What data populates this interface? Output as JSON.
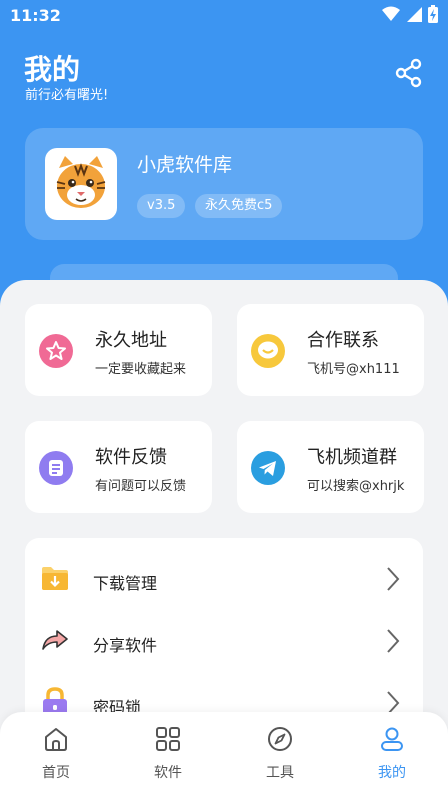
{
  "status_bar": {
    "time": "11:32"
  },
  "header": {
    "title": "我的",
    "subtitle": "前行必有曙光!"
  },
  "profile": {
    "name": "小虎软件库",
    "version": "v3.5",
    "badge": "永久免费c5"
  },
  "grid": [
    {
      "title": "永久地址",
      "sub": "一定要收藏起来",
      "icon": "star-icon",
      "color": "#f06a95"
    },
    {
      "title": "合作联系",
      "sub": "飞机号@xh111",
      "icon": "chat-bubble-icon",
      "color": "#f7c83c"
    },
    {
      "title": "软件反馈",
      "sub": "有问题可以反馈",
      "icon": "feedback-icon",
      "color": "#8f7cf0"
    },
    {
      "title": "飞机频道群",
      "sub": "可以搜索@xhrjk",
      "icon": "telegram-icon",
      "color": "#2a9ee0"
    }
  ],
  "menu": [
    {
      "label": "下载管理",
      "icon": "download-folder-icon"
    },
    {
      "label": "分享软件",
      "icon": "share-arrow-icon"
    },
    {
      "label": "密码锁",
      "icon": "lock-icon"
    }
  ],
  "nav": [
    {
      "label": "首页",
      "icon": "home-icon"
    },
    {
      "label": "软件",
      "icon": "grid-icon"
    },
    {
      "label": "工具",
      "icon": "compass-icon"
    },
    {
      "label": "我的",
      "icon": "user-icon"
    }
  ],
  "colors": {
    "brand": "#3c95f2",
    "background": "#f2f3f5"
  }
}
